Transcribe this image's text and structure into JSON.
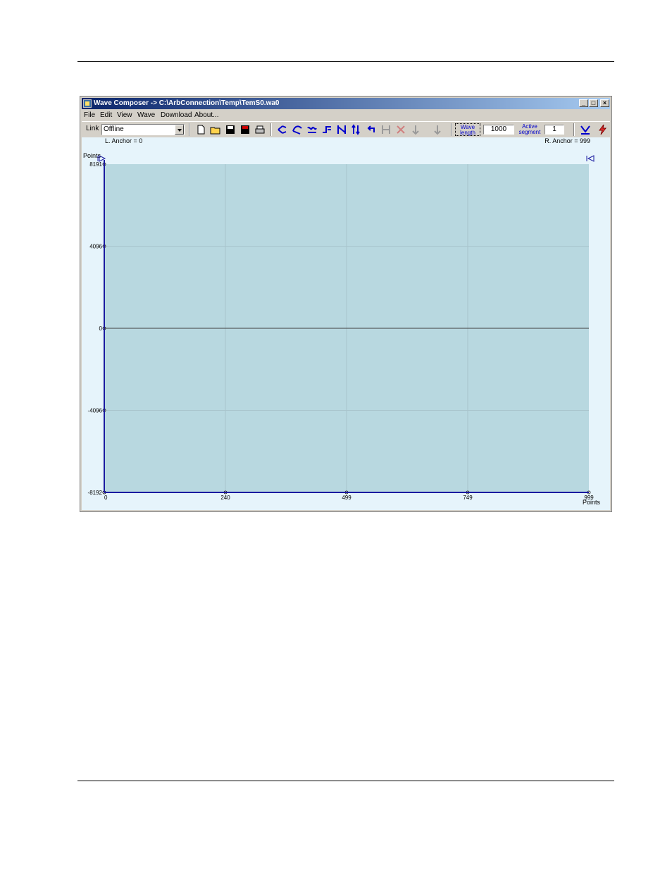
{
  "window": {
    "title": "Wave Composer -> C:\\ArbConnection\\Temp\\TemS0.wa0",
    "buttons": {
      "minimize": "_",
      "maximize": "□",
      "close": "×"
    }
  },
  "menu": [
    "File",
    "Edit",
    "View",
    "Wave",
    "Download",
    "About..."
  ],
  "toolbar": {
    "link_label": "Link",
    "link_value": "Offline",
    "wave_length_label": "Wave length",
    "wave_length_value": "1000",
    "active_segment_label": "Active segment",
    "active_segment_value": "1",
    "icons": [
      "new-file-icon",
      "open-folder-icon",
      "save-icon",
      "save-as-icon",
      "print-icon",
      "draw-line-icon",
      "draw-curve-icon",
      "wave-smooth-icon",
      "level-icon",
      "marker-icon",
      "anchor-icon",
      "undo-icon",
      "disabled-icon-1",
      "disabled-icon-2",
      "disabled-icon-3",
      "disabled-icon-4",
      "download-icon",
      "lightning-icon"
    ]
  },
  "chart_data": {
    "type": "line",
    "left_anchor_label": "L. Anchor = 0",
    "right_anchor_label": "R. Anchor = 999",
    "ylabel": "Points",
    "xlabel": "Points",
    "y_ticks": [
      "8191",
      "4096",
      "0",
      "-4096",
      "-8192"
    ],
    "x_ticks": [
      "0",
      "240",
      "499",
      "749",
      "999"
    ],
    "xlim": [
      0,
      999
    ],
    "ylim": [
      -8192,
      8191
    ],
    "series": [
      {
        "x": [
          0,
          999
        ],
        "y": [
          0,
          0
        ]
      }
    ],
    "grid": true,
    "plot_color": "#b8d8e0"
  }
}
